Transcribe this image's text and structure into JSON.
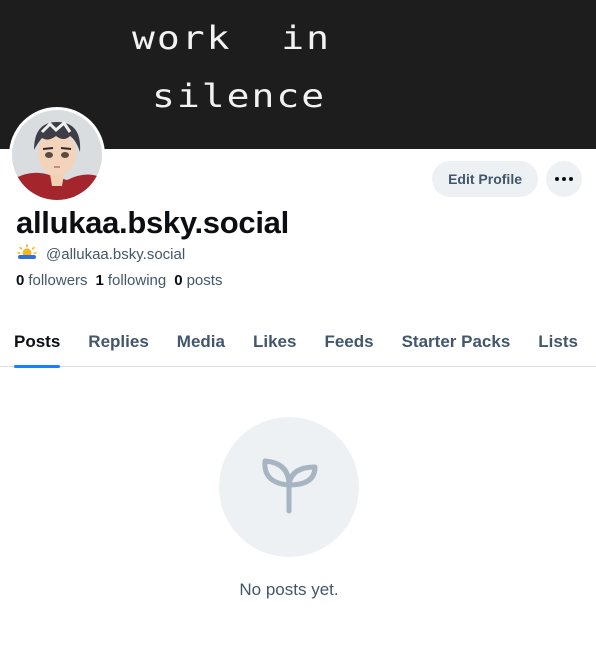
{
  "banner": {
    "line1": "work  in",
    "line2": "silence"
  },
  "profile": {
    "display_name": "allukaa.bsky.social",
    "handle": "@allukaa.bsky.social",
    "handle_icon": "sun-cloud-icon"
  },
  "actions": {
    "edit_label": "Edit Profile",
    "more_icon": "ellipsis-icon"
  },
  "stats": {
    "followers_count": "0",
    "followers_label": "followers",
    "following_count": "1",
    "following_label": "following",
    "posts_count": "0",
    "posts_label": "posts"
  },
  "tabs": [
    {
      "label": "Posts",
      "active": true
    },
    {
      "label": "Replies"
    },
    {
      "label": "Media"
    },
    {
      "label": "Likes"
    },
    {
      "label": "Feeds"
    },
    {
      "label": "Starter Packs"
    },
    {
      "label": "Lists"
    }
  ],
  "empty_state": {
    "icon": "sprout-icon",
    "message": "No posts yet."
  },
  "colors": {
    "accent": "#1083fe",
    "muted_text": "#42576c",
    "button_bg": "#eef1f4",
    "banner_bg": "#1d1d1d"
  }
}
